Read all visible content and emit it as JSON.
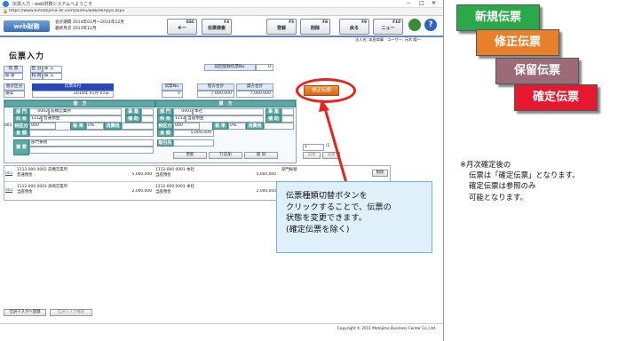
{
  "window": {
    "title": "伝票入力 - web財務システムへようこそ",
    "url": "https://www.kimotojima-dc.com/zaimu/web/denpyo.aspx"
  },
  "header": {
    "logo": "web財務",
    "period_line1": "会計期間 2014年01月〜2014年12月",
    "period_line2": "最終月次 2013年12月",
    "fkeys": [
      {
        "key": "ESC",
        "label": "キー"
      },
      {
        "key": "F3",
        "label": "伝票検索"
      },
      {
        "key": "F5",
        "label": "登録"
      },
      {
        "key": "F8",
        "label": "削除"
      },
      {
        "key": "F9",
        "label": "戻る"
      },
      {
        "key": "F10",
        "label": "ニュー"
      }
    ],
    "user": "法人名: 本島商事　ユーザー: 元木 陽一"
  },
  "form": {
    "page_title": "伝票入力",
    "denpyo_label": "伝 票",
    "denpyo_value": "振 替",
    "kubun_label": "区 分",
    "kubun_value": "振 方",
    "kamoku_label": "科 目",
    "kamoku_value": "振 方",
    "prev_no_label": "前回登録伝票No.",
    "prev_no_value": "0",
    "kaikei_kubun_label": "会計区分",
    "kaikei_kubun_value": "通常",
    "date_label": "伝票日付",
    "date_value": "2014年 01月 01日",
    "no_label": "伝票No.",
    "no_value": "0",
    "debit_total_label": "借方合計",
    "debit_total_value": "7,000,000",
    "credit_total_label": "貸方合計",
    "credit_total_value": "7,000,000",
    "switch_button": "修正伝票",
    "debit_header": "借　方",
    "credit_header": "貸　方",
    "row_labels": {
      "bumon": "部 門",
      "kamoku": "科 目",
      "kazei": "税区分",
      "kingaku": "金 額",
      "tekiyo": "摘 要",
      "jigyo": "事 業",
      "hojo": "補 助",
      "zeiritsu": "税 率",
      "shohizei": "消費税",
      "torihiki": "取引先"
    },
    "debit": {
      "bumon_code": "0002",
      "bumon_name": "前橋営業所",
      "kamoku_code": "1112",
      "kamoku_name": "普通預金",
      "kazei": "000",
      "zeiritsu": "0%",
      "kingaku": "5,000,000",
      "tekiyo": "部門振替"
    },
    "credit": {
      "bumon_code": "0001",
      "bumon_name": "本社",
      "kamoku_code": "1112",
      "kamoku_name": "当座預金",
      "kazei": "000",
      "zeiritsu": "0%",
      "kingaku": "5,000,000"
    },
    "line_no": "001",
    "mid_buttons": [
      "更新",
      "行追加",
      "復 旧"
    ],
    "page_select": "1",
    "page_total": "/1",
    "nav_buttons": [
      "前頁",
      "次頁"
    ]
  },
  "lines": [
    {
      "no": "001",
      "debit_code": "1112-000 0002 前橋営業所",
      "debit_name": "普通預金",
      "debit_amount": "5,000,000",
      "credit_code": "1112-000 0001 本社",
      "credit_name": "当座預金",
      "credit_amount": "5,000,000",
      "tekiyo": "部門振替",
      "delete": "削除"
    },
    {
      "no": "002",
      "debit_code": "1112-000 0003 高崎営業所",
      "debit_name": "当座預金",
      "debit_amount": "2,000,000",
      "credit_code": "1112-000 0001 本社",
      "credit_name": "当座預金",
      "credit_amount": "2,000,000",
      "tekiyo": "",
      "delete": ""
    }
  ],
  "bottom_buttons": [
    "仕訳マスタへ登録",
    "仕訳マスタ検索"
  ],
  "footer": "Copyright © 2011 Motojima Business Center Co.,Ltd.",
  "callout": {
    "line1": "伝票種類切替ボタンを",
    "line2": "クリックすることで、伝票の",
    "line3": "状態を変更できます。",
    "line4": "(確定伝票を除く)"
  },
  "legend": [
    {
      "label": "新規伝票",
      "color": "#2ca84a"
    },
    {
      "label": "修正伝票",
      "color": "#e7802b"
    },
    {
      "label": "保留伝票",
      "color": "#9b6b79"
    },
    {
      "label": "確定伝票",
      "color": "#e4182e"
    }
  ],
  "note": {
    "line1": "※月次確定後の",
    "line2": "伝票は「確定伝票」となります。",
    "line3": "確定伝票は参照のみ",
    "line4": "可能となります。"
  },
  "colors": {
    "accent": "#5b89c6",
    "teal": "#5aa9a4",
    "ring": "#e8231b"
  }
}
